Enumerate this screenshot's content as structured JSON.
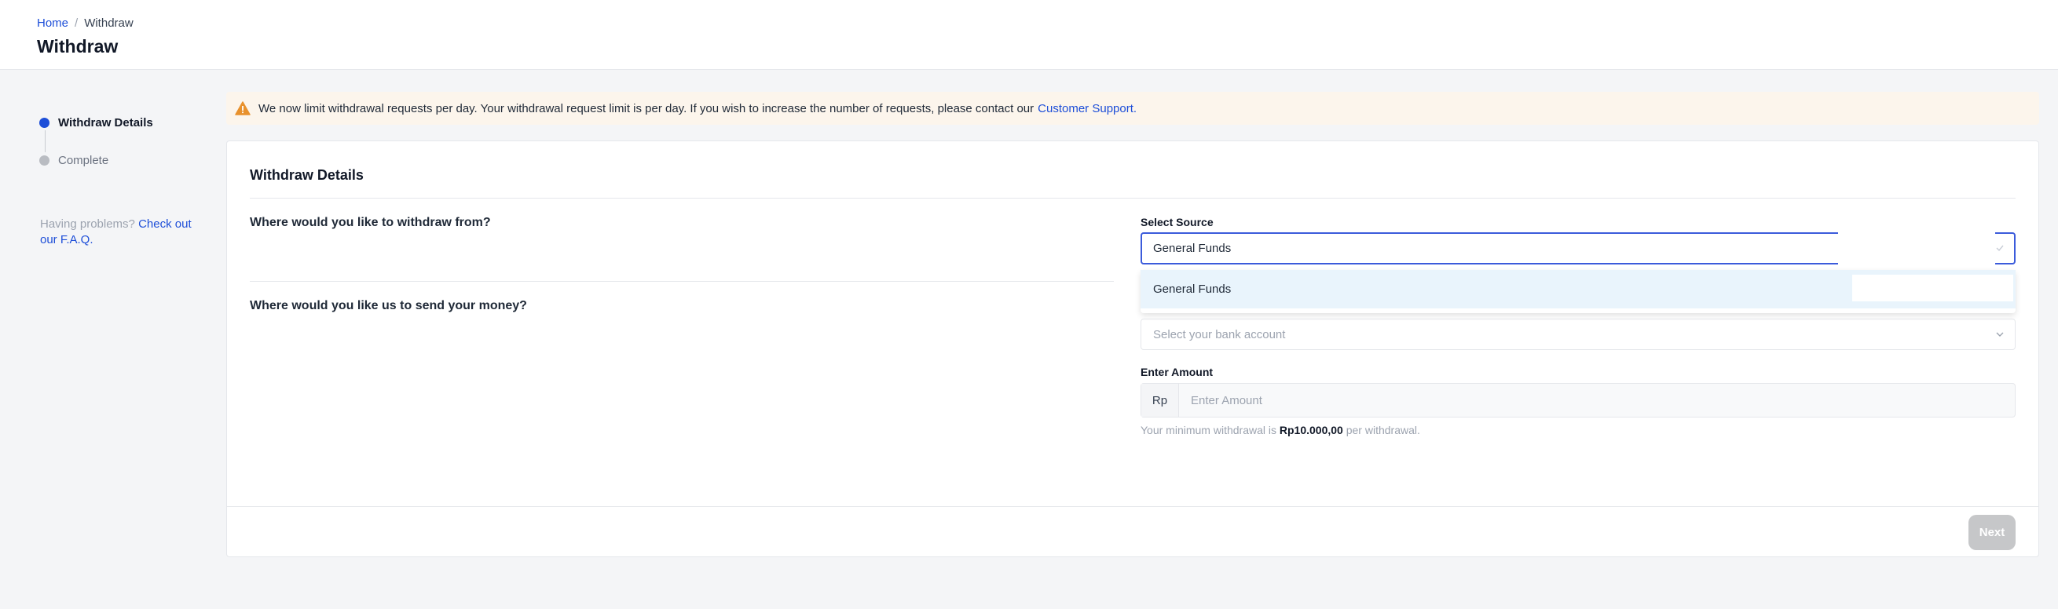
{
  "breadcrumb": {
    "home": "Home",
    "separator": "/",
    "current": "Withdraw"
  },
  "page": {
    "title": "Withdraw"
  },
  "stepper": {
    "steps": [
      {
        "label": "Withdraw Details",
        "state": "active"
      },
      {
        "label": "Complete",
        "state": "inactive"
      }
    ]
  },
  "help": {
    "prefix": "Having problems?",
    "link": "Check out our F.A.Q."
  },
  "alert": {
    "text": "We now limit withdrawal requests per day. Your withdrawal request limit is per day. If you wish to increase the number of requests, please contact our",
    "link": "Customer Support.",
    "icon": "warning-triangle-icon",
    "color": "#e8912d"
  },
  "form": {
    "title": "Withdraw Details",
    "source_question": "Where would you like to withdraw from?",
    "source_label": "Select Source",
    "source_value": "General Funds",
    "source_options": [
      "General Funds"
    ],
    "bank_question": "Where would you like us to send your money?",
    "bank_placeholder": "Select your bank account",
    "amount_label": "Enter Amount",
    "amount_prefix": "Rp",
    "amount_placeholder": "Enter Amount",
    "hint_prefix": "Your minimum withdrawal is",
    "hint_amount": "Rp10.000,00",
    "hint_suffix": "per withdrawal.",
    "next_label": "Next"
  },
  "colors": {
    "primary": "#1d4ed8",
    "focus_border": "#3b5bdb",
    "disabled_button": "#c6c7c9",
    "alert_bg": "#fcf5ec"
  }
}
